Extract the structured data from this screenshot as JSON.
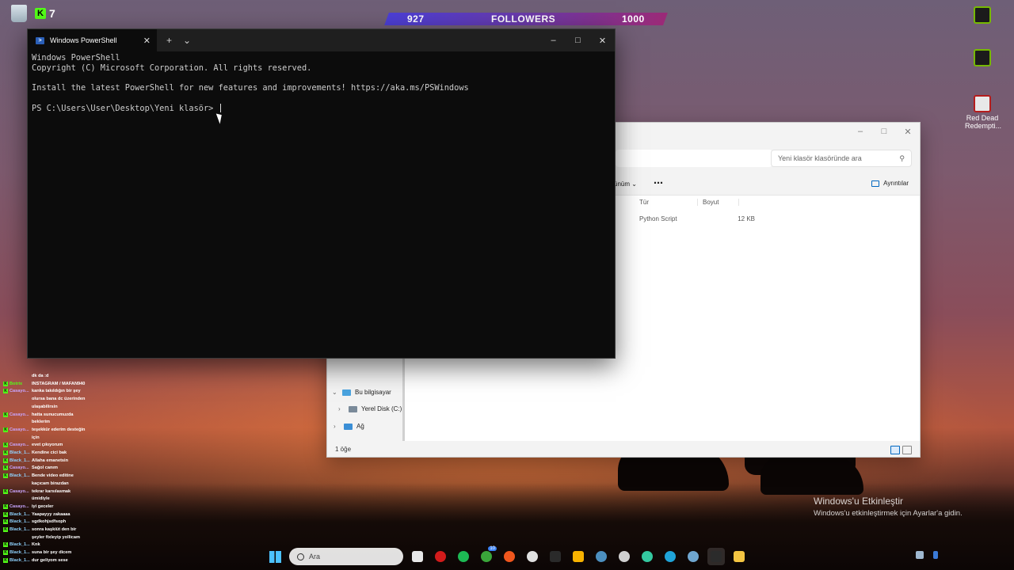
{
  "overlay": {
    "kick_count": "7",
    "followers": {
      "current": "927",
      "label": "FOLLOWERS",
      "goal": "1000"
    }
  },
  "desktop": {
    "icons": [
      {
        "label": "Red Dead Redempti..."
      }
    ]
  },
  "powershell": {
    "tab_title": "Windows PowerShell",
    "lines": [
      "Windows PowerShell",
      "Copyright (C) Microsoft Corporation. All rights reserved.",
      "",
      "Install the latest PowerShell for new features and improvements! https://aka.ms/PSWindows",
      "",
      "PS C:\\Users\\User\\Desktop\\Yeni klasör> "
    ]
  },
  "explorer": {
    "search_placeholder": "Yeni klasör klasöründe ara",
    "view_label": "ünüm",
    "details_label": "Ayrıntılar",
    "columns": [
      "Tür",
      "Boyut"
    ],
    "rows": [
      {
        "type": "Python Script",
        "size": "12 KB"
      }
    ],
    "nav": {
      "this_pc": "Bu bilgisayar",
      "local_disk": "Yerel Disk (C:)",
      "network": "Ağ"
    },
    "status": "1 öğe"
  },
  "chat": [
    {
      "user": "",
      "message": "dk da :d",
      "color": "#ffffff",
      "kick": false
    },
    {
      "user": "Botrix",
      "message": "INSTAGRAM / MAFAN940",
      "color": "#53fc18",
      "kick": true
    },
    {
      "user": "Casayo...",
      "message": "kanka takıldığın bir şey",
      "color": "#c9a6ff",
      "kick": true
    },
    {
      "user": "",
      "message": "olursa bana dc üzerinden",
      "color": "#ffffff",
      "kick": false
    },
    {
      "user": "",
      "message": "ulaşabilirsin",
      "color": "#ffffff",
      "kick": false
    },
    {
      "user": "Casayo...",
      "message": "hatta sunucumuzda",
      "color": "#c9a6ff",
      "kick": true
    },
    {
      "user": "",
      "message": "beklerim",
      "color": "#ffffff",
      "kick": false
    },
    {
      "user": "Casayo...",
      "message": "teşekkür ederim desteğin",
      "color": "#c9a6ff",
      "kick": true
    },
    {
      "user": "",
      "message": "için",
      "color": "#ffffff",
      "kick": false
    },
    {
      "user": "Casayo...",
      "message": "evet çıkıyorum",
      "color": "#c9a6ff",
      "kick": true
    },
    {
      "user": "Black_1...",
      "message": "Kendine cici bak",
      "color": "#8fd3ff",
      "kick": true
    },
    {
      "user": "Black_1...",
      "message": "Allaha emanetsin",
      "color": "#8fd3ff",
      "kick": true
    },
    {
      "user": "Casayo...",
      "message": "Sağol canım",
      "color": "#c9a6ff",
      "kick": true
    },
    {
      "user": "Black_1...",
      "message": "Bende video editine",
      "color": "#8fd3ff",
      "kick": true
    },
    {
      "user": "",
      "message": "kaçıcam birazdan",
      "color": "#ffffff",
      "kick": false
    },
    {
      "user": "Casayo...",
      "message": "tekrar karsılasmak",
      "color": "#c9a6ff",
      "kick": true
    },
    {
      "user": "",
      "message": "ümidiyle",
      "color": "#ffffff",
      "kick": false
    },
    {
      "user": "Casayo...",
      "message": "iyi geceler",
      "color": "#c9a6ff",
      "kick": true
    },
    {
      "user": "Black_1...",
      "message": "Yaapayyy zakaaaa",
      "color": "#8fd3ff",
      "kick": true
    },
    {
      "user": "Black_1...",
      "message": "sgdkohjsdfsoph",
      "color": "#8fd3ff",
      "kick": true
    },
    {
      "user": "Black_1...",
      "message": "sonra kaşkiüt den bir",
      "color": "#8fd3ff",
      "kick": true
    },
    {
      "user": "",
      "message": "şeyler fixleyip yollicam",
      "color": "#ffffff",
      "kick": false
    },
    {
      "user": "Black_1...",
      "message": "Knk",
      "color": "#8fd3ff",
      "kick": true
    },
    {
      "user": "Black_1...",
      "message": "suna bir şey dicem",
      "color": "#8fd3ff",
      "kick": true
    },
    {
      "user": "Black_1...",
      "message": "dur geliyom sese",
      "color": "#8fd3ff",
      "kick": true
    }
  ],
  "watermark": {
    "title": "Windows'u Etkinleştir",
    "subtitle": "Windows'u etkinleştirmek için Ayarlar'a gidin."
  },
  "taskbar": {
    "search_placeholder": "Ara",
    "xbox_badge": "10",
    "apps": [
      {
        "icon": "file-icon",
        "color": "#e8e8e8"
      },
      {
        "icon": "red-app-icon",
        "color": "#d21b1b"
      },
      {
        "icon": "spotify-icon",
        "color": "#1db954"
      },
      {
        "icon": "xbox-icon",
        "color": "#3aa53a"
      },
      {
        "icon": "origin-icon",
        "color": "#f0561d"
      },
      {
        "icon": "ring-icon",
        "color": "#e0e0e0"
      },
      {
        "icon": "epic-icon",
        "color": "#2a2a2a"
      },
      {
        "icon": "rockstar-icon",
        "color": "#f7b200"
      },
      {
        "icon": "steam-icon",
        "color": "#4c8fbf"
      },
      {
        "icon": "chrome-icon",
        "color": "#d0d0d0"
      },
      {
        "icon": "discord-icon",
        "color": "#34c8a0"
      },
      {
        "icon": "edge-icon",
        "color": "#1fa3d8"
      },
      {
        "icon": "steam-alt-icon",
        "color": "#6fa6d0"
      },
      {
        "icon": "terminal-icon",
        "color": "#2b2b2b"
      },
      {
        "icon": "folder-icon",
        "color": "#f4c542"
      }
    ]
  }
}
